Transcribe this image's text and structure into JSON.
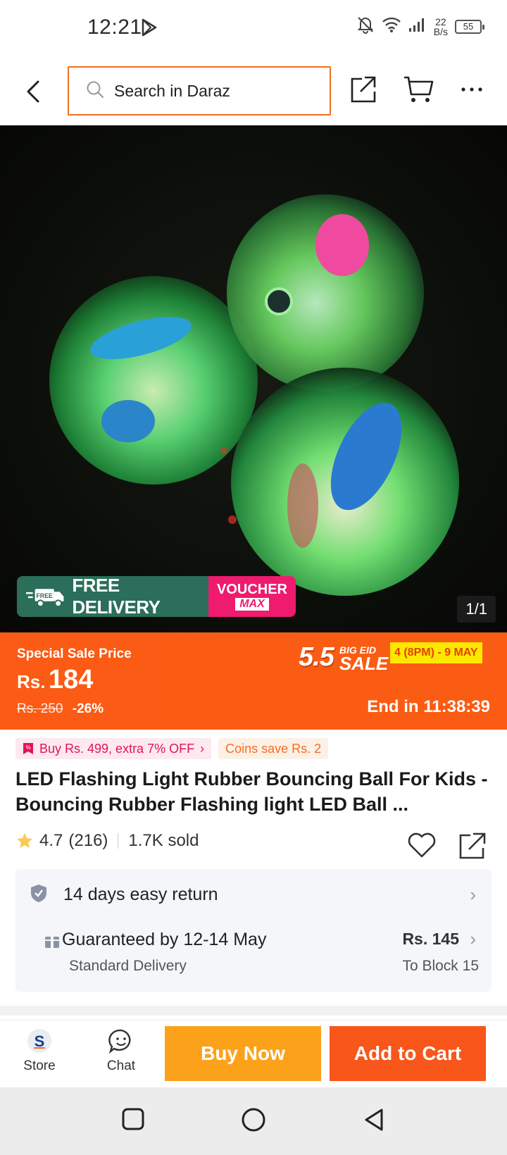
{
  "status_bar": {
    "time": "12:21",
    "net_speed_value": "22",
    "net_speed_unit": "B/s",
    "battery": "55"
  },
  "top_nav": {
    "search_placeholder": "Search in Daraz"
  },
  "hero": {
    "free_delivery_label": "FREE DELIVERY",
    "free_badge": "FREE",
    "voucher_line1": "VOUCHER",
    "voucher_line2": "MAX",
    "image_counter": "1/1"
  },
  "price": {
    "special_label": "Special Sale Price",
    "currency": "Rs.",
    "amount": "184",
    "old_price": "Rs. 250",
    "discount": "-26%",
    "sale_number": "5.5",
    "sale_word_small": "BIG EID",
    "sale_word_big": "SALE",
    "sale_dates": "4 (8PM) - 9 MAY",
    "countdown": "End in 11:38:39"
  },
  "promos": {
    "chip1": "Buy Rs. 499, extra 7% OFF",
    "chip2": "Coins save Rs. 2"
  },
  "product": {
    "title": "LED Flashing Light Rubber Bouncing Ball For Kids - Bouncing Rubber Flashing light LED Ball ...",
    "rating": "4.7",
    "reviews": "(216)",
    "sold": "1.7K sold"
  },
  "services": {
    "returns": "14 days easy return",
    "delivery_guarantee": "Guaranteed by 12-14 May",
    "delivery_type": "Standard Delivery",
    "delivery_fee": "Rs. 145",
    "delivery_to": "To Block 15"
  },
  "action_bar": {
    "store_label": "Store",
    "chat_label": "Chat",
    "buy_now": "Buy Now",
    "add_to_cart": "Add to Cart"
  },
  "colors": {
    "brand_orange": "#f8561a",
    "buy_now_yellow": "#fca21a",
    "free_delivery_green": "#2b6e5a",
    "voucher_pink": "#ee1b6e"
  }
}
